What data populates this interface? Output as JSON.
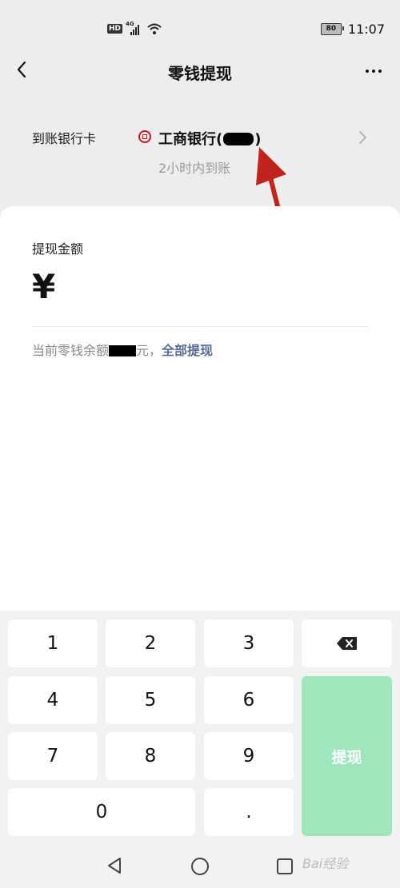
{
  "status_bar": {
    "hd": "HD",
    "network": "4G",
    "battery": "80",
    "time": "11:07"
  },
  "nav": {
    "title": "零钱提现",
    "back_icon": "chevron-left-icon",
    "more_icon": "more-dots-icon"
  },
  "bank": {
    "label": "到账银行卡",
    "name_prefix": "工商银行(",
    "name_suffix": ")",
    "arrival": "2小时内到账",
    "bank_icon": "icbc-logo-icon",
    "colors": {
      "brand": "#c8161d"
    }
  },
  "card": {
    "amount_label": "提现金额",
    "currency": "¥",
    "balance_prefix": "当前零钱余额",
    "balance_suffix": "元，",
    "withdraw_all": "全部提现"
  },
  "keypad": {
    "keys": [
      "1",
      "2",
      "3",
      "4",
      "5",
      "6",
      "7",
      "8",
      "9",
      "0",
      "."
    ],
    "delete_icon": "backspace-icon",
    "submit": "提现",
    "colors": {
      "submit_bg": "#9fe5be",
      "link": "#576b95"
    }
  },
  "watermark": "Bai经验"
}
